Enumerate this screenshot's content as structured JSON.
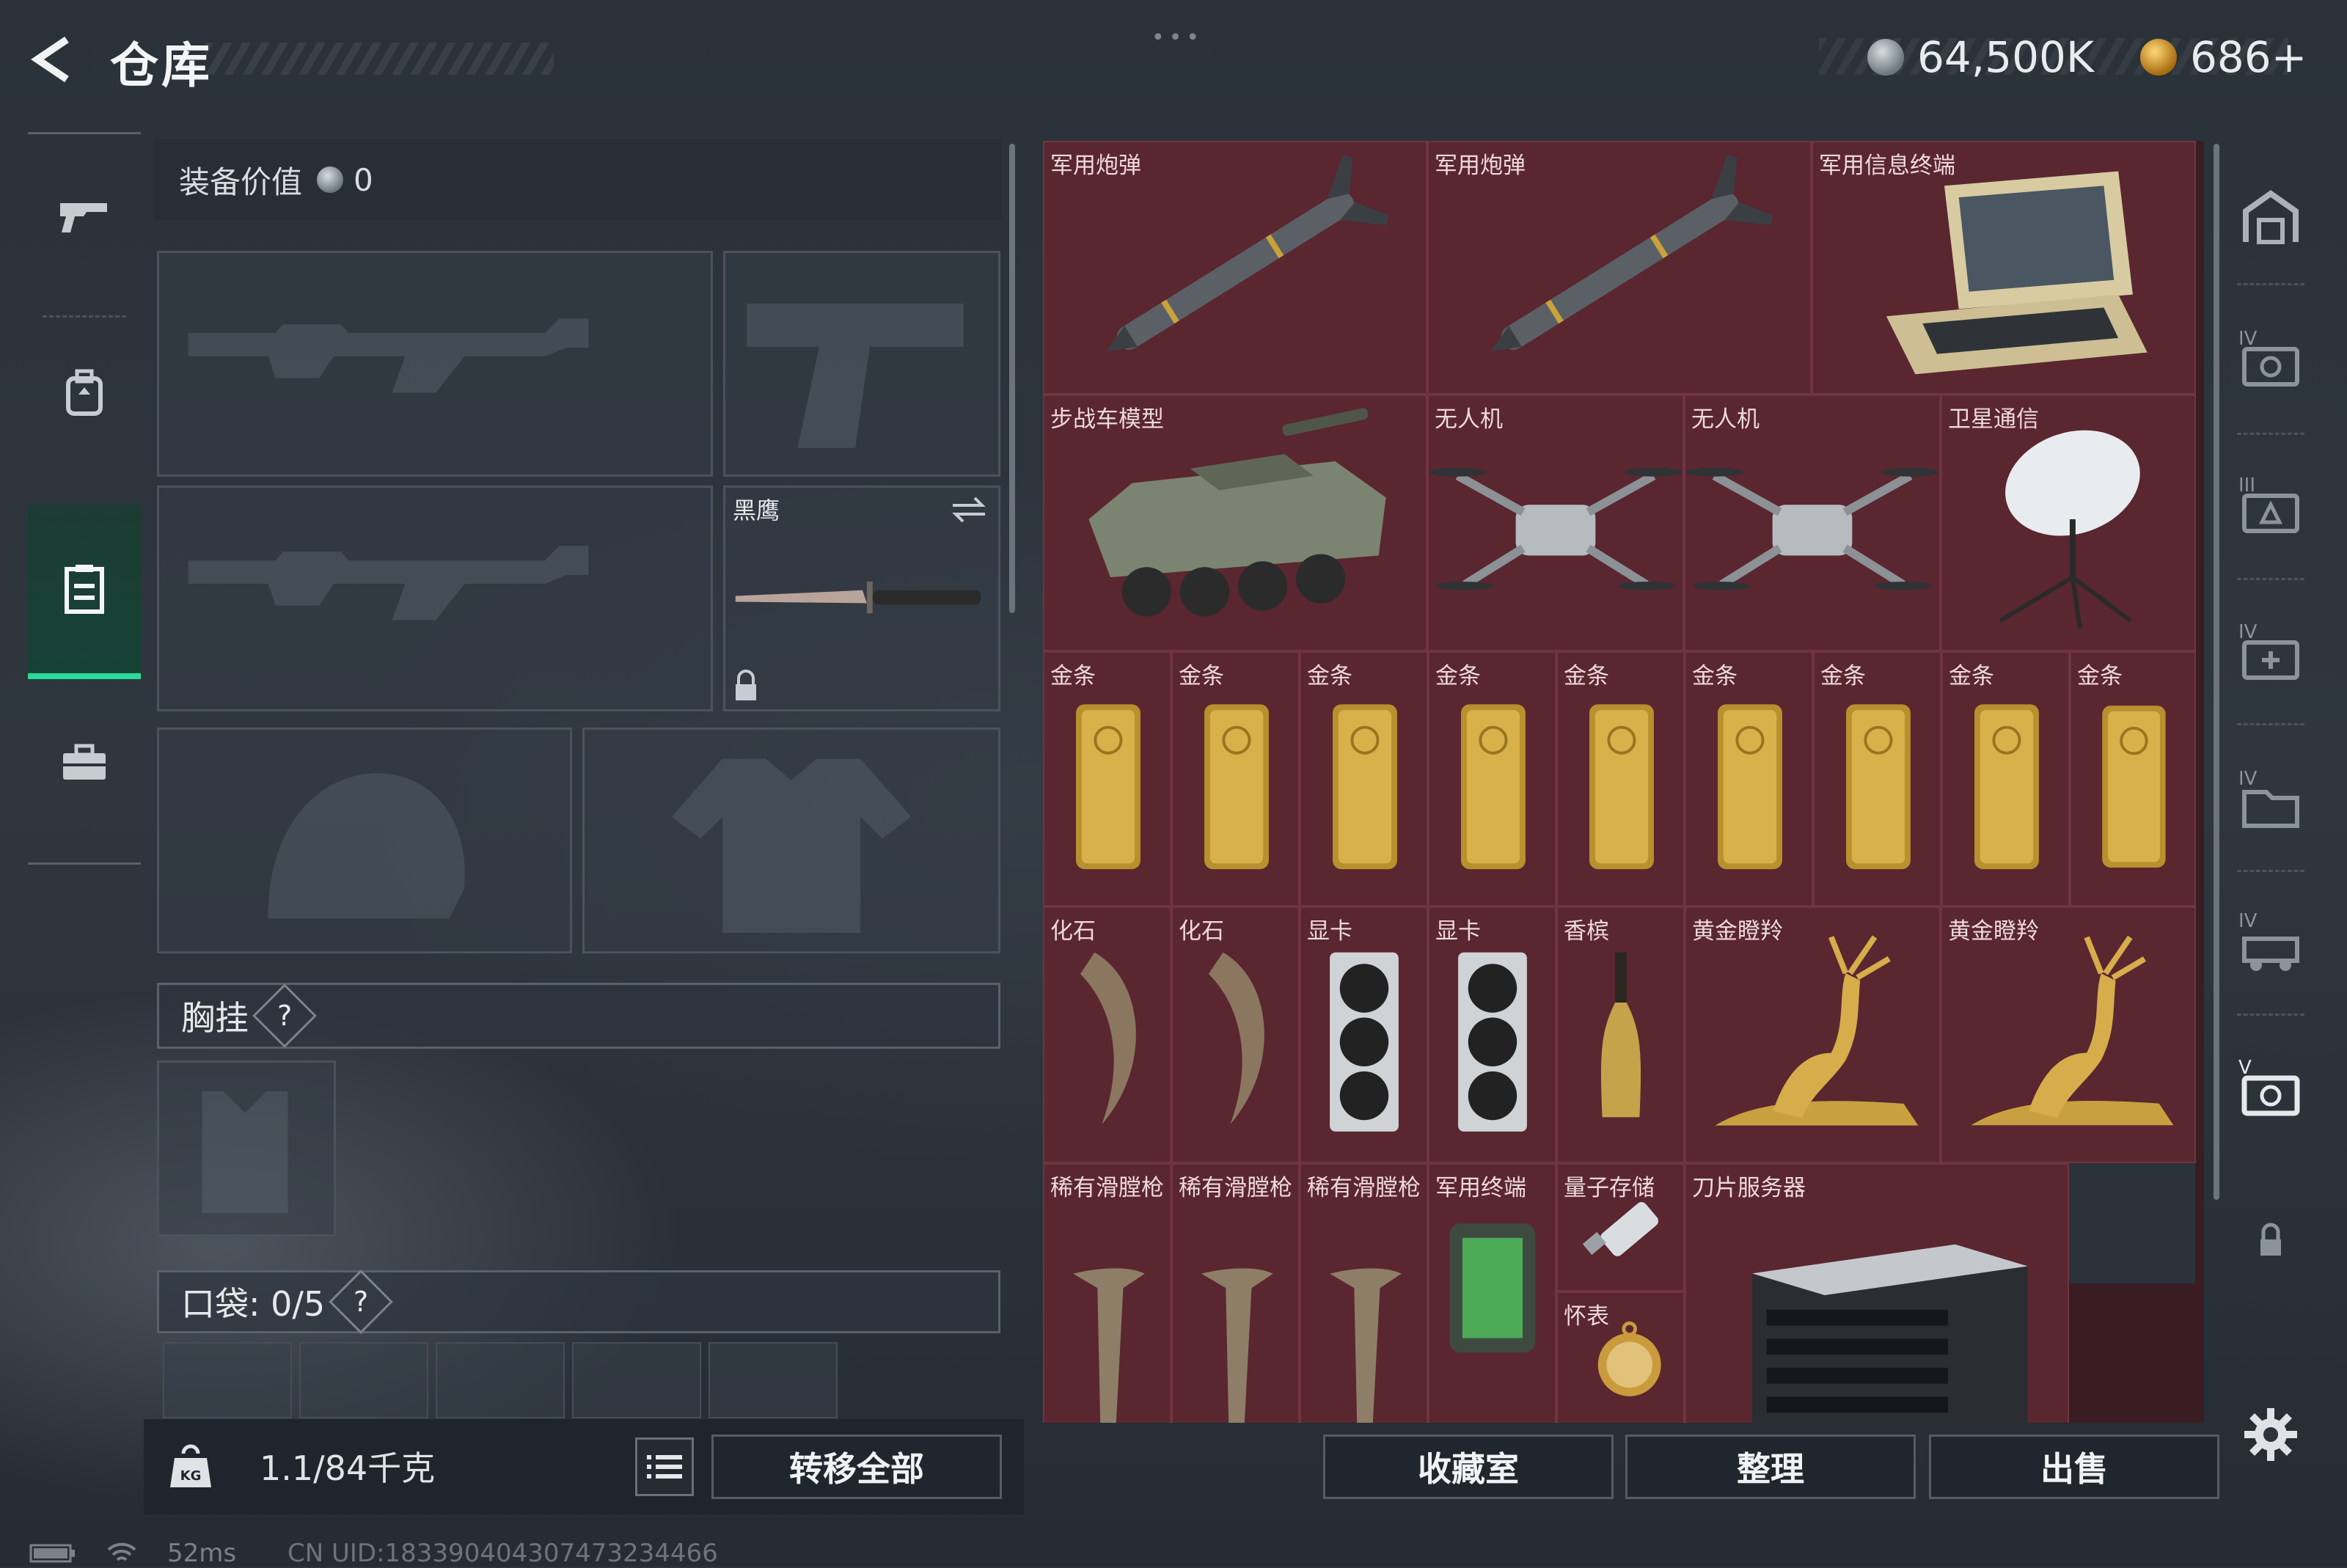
{
  "header": {
    "title": "仓库",
    "currency1": "64,500K",
    "currency2": "686+",
    "menu_dots": "•••"
  },
  "left_nav": {
    "items": [
      {
        "name": "weapons-tab",
        "icon": "gun-icon"
      },
      {
        "name": "backpack-tab",
        "icon": "backpack-icon"
      },
      {
        "name": "storage-tab",
        "icon": "locker-icon",
        "active": true
      },
      {
        "name": "case-tab",
        "icon": "briefcase-icon"
      }
    ]
  },
  "equipment": {
    "value_label": "装备价值",
    "value": "0",
    "melee_label": "黑鹰",
    "chest_rig_label": "胸挂",
    "chest_rig_help": "?",
    "pocket_label": "口袋: 0/5",
    "pocket_help": "?"
  },
  "footer_left": {
    "weight": "1.1/84千克",
    "transfer_all": "转移全部"
  },
  "footer_right": {
    "collection": "收藏室",
    "organize": "整理",
    "sell": "出售"
  },
  "inventory": {
    "row1": [
      "军用炮弹",
      "军用炮弹",
      "军用信息终端"
    ],
    "row2": [
      "步战车模型",
      "无人机",
      "无人机",
      "卫星通信"
    ],
    "row3": [
      "金条",
      "金条",
      "金条",
      "金条",
      "金条",
      "金条",
      "金条",
      "金条",
      "金条"
    ],
    "row4": [
      "化石",
      "化石",
      "显卡",
      "显卡",
      "香槟",
      "黄金瞪羚",
      "黄金瞪羚"
    ],
    "row5": [
      "稀有滑膛枪",
      "稀有滑膛枪",
      "稀有滑膛枪",
      "军用终端",
      "量子存储",
      "怀表",
      "刀片服务器"
    ]
  },
  "status_bar": {
    "ping": "52ms",
    "uid": "CN UID:18339040430747323446​6"
  },
  "colors": {
    "accent": "#2bd99a",
    "cell_bg": "#5a2630",
    "panel_bg": "#2c333c"
  }
}
